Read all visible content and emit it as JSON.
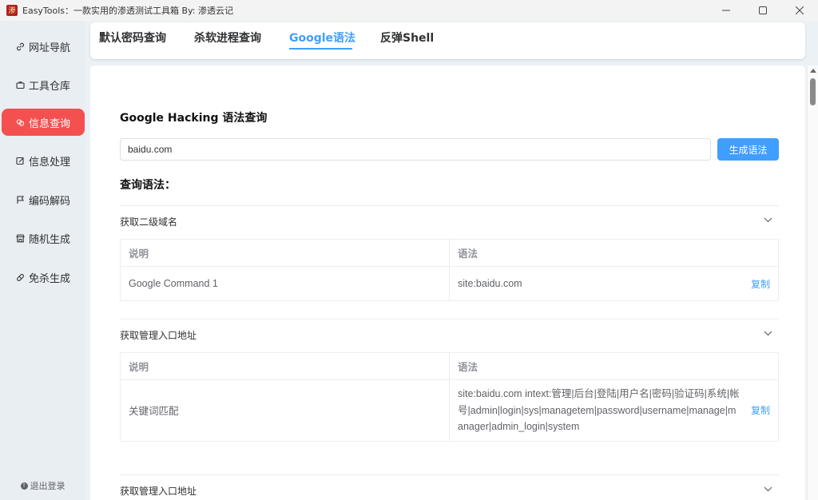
{
  "titlebar": {
    "icon_glyph": "渗",
    "title": "EasyTools：一款实用的渗透测试工具箱 By: 渗透云记",
    "icons": [
      "minimize-icon",
      "maximize-icon",
      "close-icon"
    ]
  },
  "sidebar": {
    "items": [
      {
        "label": "网址导航",
        "icon": "link-icon",
        "active": false
      },
      {
        "label": "工具仓库",
        "icon": "briefcase-icon",
        "active": false
      },
      {
        "label": "信息查询",
        "icon": "chain-icon",
        "active": true
      },
      {
        "label": "信息处理",
        "icon": "edit-icon",
        "active": false
      },
      {
        "label": "编码解码",
        "icon": "flag-icon",
        "active": false
      },
      {
        "label": "随机生成",
        "icon": "shop-icon",
        "active": false
      },
      {
        "label": "免杀生成",
        "icon": "pill-icon",
        "active": false
      }
    ],
    "logout_label": "退出登录"
  },
  "tabs": [
    {
      "label": "默认密码查询",
      "active": false
    },
    {
      "label": "杀软进程查询",
      "active": false
    },
    {
      "label": "Google语法",
      "active": true
    },
    {
      "label": "反弹Shell",
      "active": false
    }
  ],
  "main": {
    "heading": "Google Hacking 语法查询",
    "search_value": "baidu.com",
    "generate_label": "生成语法",
    "results_heading": "查询语法：",
    "sections": [
      {
        "title": "获取二级域名",
        "col_desc": "说明",
        "col_syntax": "语法",
        "rows": [
          {
            "desc": "Google Command 1",
            "syntax": "site:baidu.com",
            "copy": "复制"
          }
        ]
      },
      {
        "title": "获取管理入口地址",
        "col_desc": "说明",
        "col_syntax": "语法",
        "rows": [
          {
            "desc": "关键词匹配",
            "syntax": "site:baidu.com intext:管理|后台|登陆|用户名|密码|验证码|系统|帐号|admin|login|sys|managetem|password|username|manage|manager|admin_login|system",
            "copy": "复制"
          }
        ]
      },
      {
        "title": "获取管理入口地址"
      }
    ]
  },
  "colors": {
    "accent": "#409eff",
    "active_nav": "#f45050"
  }
}
